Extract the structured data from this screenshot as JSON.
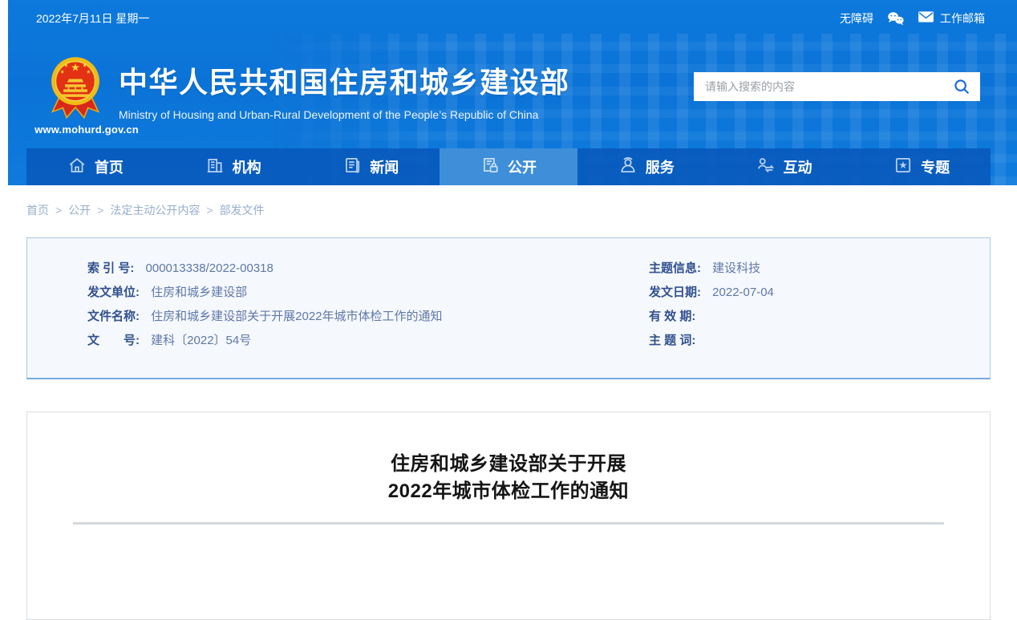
{
  "topbar": {
    "date": "2022年7月11日 星期一",
    "accessibility": "无障碍",
    "mailbox": "工作邮箱"
  },
  "header": {
    "site_url": "www.mohurd.gov.cn",
    "title_cn": "中华人民共和国住房和城乡建设部",
    "title_en": "Ministry of Housing and Urban-Rural Development of the People’s Republic of China",
    "search_placeholder": "请输入搜索的内容"
  },
  "nav": {
    "items": [
      {
        "label": "首页",
        "icon": "home-icon",
        "active": false
      },
      {
        "label": "机构",
        "icon": "building-icon",
        "active": false
      },
      {
        "label": "新闻",
        "icon": "news-icon",
        "active": false
      },
      {
        "label": "公开",
        "icon": "doc-lock-icon",
        "active": true
      },
      {
        "label": "服务",
        "icon": "person-icon",
        "active": false
      },
      {
        "label": "互动",
        "icon": "person-arrows-icon",
        "active": false
      },
      {
        "label": "专题",
        "icon": "star-square-icon",
        "active": false
      }
    ]
  },
  "breadcrumb": {
    "items": [
      "首页",
      "公开",
      "法定主动公开内容",
      "部发文件"
    ],
    "separator": ">"
  },
  "doc_info": {
    "left": [
      {
        "label": "索 引 号:",
        "value": "000013338/2022-00318"
      },
      {
        "label": "发文单位:",
        "value": "住房和城乡建设部"
      },
      {
        "label": "文件名称:",
        "value": "住房和城乡建设部关于开展2022年城市体检工作的通知"
      },
      {
        "label": "文　　号:",
        "value": "建科〔2022〕54号"
      }
    ],
    "right": [
      {
        "label": "主题信息:",
        "value": "建设科技"
      },
      {
        "label": "发文日期:",
        "value": "2022-07-04"
      },
      {
        "label": "有 效 期:",
        "value": ""
      },
      {
        "label": "主 题 词:",
        "value": ""
      }
    ]
  },
  "article": {
    "title_line1": "住房和城乡建设部关于开展",
    "title_line2": "2022年城市体检工作的通知"
  },
  "icons": {
    "emblem": "china-national-emblem",
    "wechat": "chat-bubbles",
    "mail": "envelope",
    "search": "magnifier",
    "nav": [
      "house",
      "building",
      "newspaper",
      "document-lock",
      "person",
      "person-arrows",
      "star-in-square"
    ]
  },
  "colors": {
    "header_blue": "#0c75d9",
    "nav_blue": "#0a5dbd",
    "nav_active_blue": "#3e8ed9",
    "info_box_bg": "#f5f8fd",
    "info_box_border": "#a9c7e6",
    "label_navy": "#31508d",
    "value_blue_gray": "#5e78a8",
    "breadcrumb_blue": "#97aecd",
    "search_icon_blue": "#1668dc",
    "emblem_red": "#e23113",
    "emblem_gold": "#f0bb16"
  }
}
